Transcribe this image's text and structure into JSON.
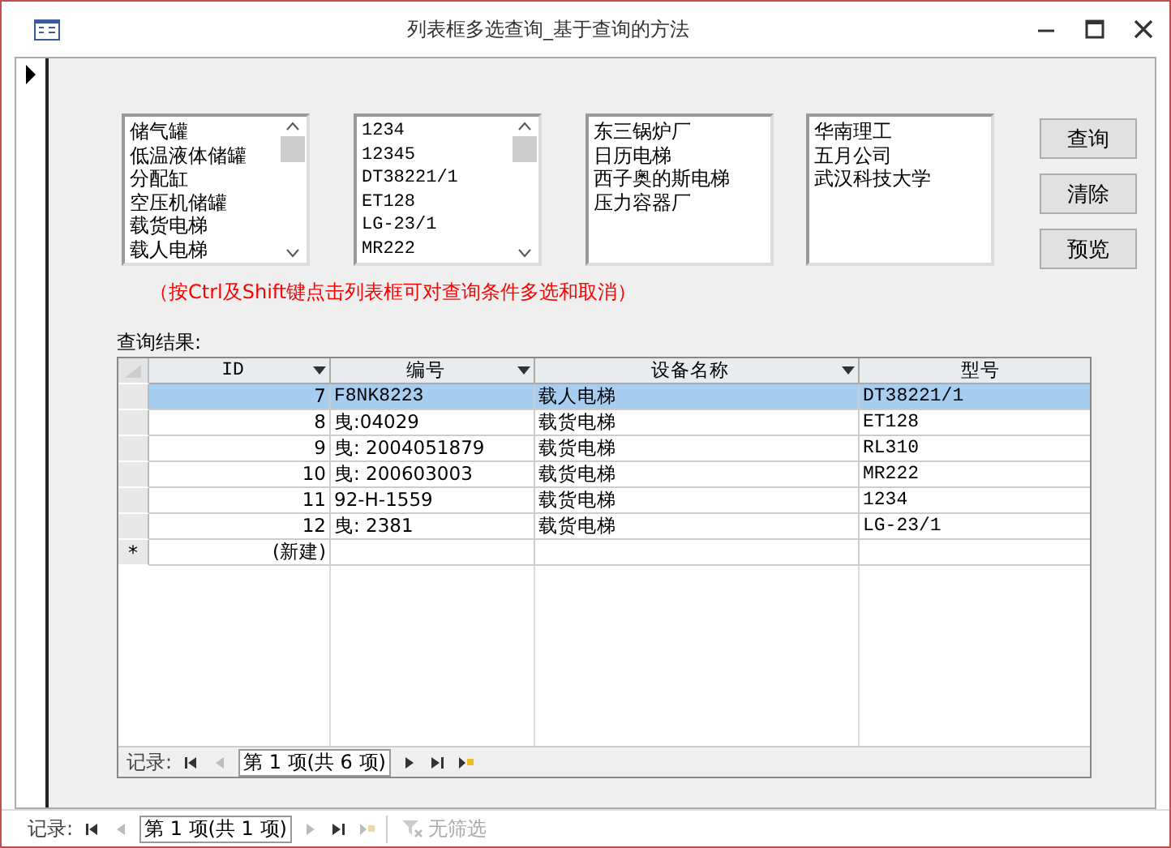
{
  "window": {
    "title": "列表框多选查询_基于查询的方法"
  },
  "listboxes": [
    {
      "items": [
        "储气罐",
        "低温液体储罐",
        "分配缸",
        "空压机储罐",
        "载货电梯",
        "载人电梯"
      ],
      "scrollbar": true
    },
    {
      "items": [
        "1234",
        "12345",
        "DT38221/1",
        "ET128",
        "LG-23/1",
        "MR222"
      ],
      "scrollbar": true
    },
    {
      "items": [
        "东三锅炉厂",
        "日历电梯",
        "西子奥的斯电梯",
        "压力容器厂"
      ],
      "scrollbar": false
    },
    {
      "items": [
        "华南理工",
        "五月公司",
        "武汉科技大学"
      ],
      "scrollbar": false
    }
  ],
  "buttons": [
    "查询",
    "清除",
    "预览"
  ],
  "hint": "（按Ctrl及Shift键点击列表框可对查询条件多选和取消）",
  "results_label": "查询结果:",
  "table": {
    "columns": [
      {
        "label": "ID",
        "dropdown": true
      },
      {
        "label": "编号",
        "dropdown": true
      },
      {
        "label": "设备名称",
        "dropdown": true
      },
      {
        "label": "型号",
        "dropdown": false
      }
    ],
    "rows": [
      {
        "cells": [
          "7",
          "F8NK8223",
          "载人电梯",
          "DT38221/1"
        ],
        "selected": true
      },
      {
        "cells": [
          "8",
          "曳:04029",
          "载货电梯",
          "ET128"
        ],
        "selected": false
      },
      {
        "cells": [
          "9",
          "曳: 2004051879",
          "载货电梯",
          "RL310"
        ],
        "selected": false
      },
      {
        "cells": [
          "10",
          "曳: 200603003",
          "载货电梯",
          "MR222"
        ],
        "selected": false
      },
      {
        "cells": [
          "11",
          "92-H-1559",
          "载货电梯",
          "1234"
        ],
        "selected": false
      },
      {
        "cells": [
          "12",
          "曳: 2381",
          "载货电梯",
          "LG-23/1"
        ],
        "selected": false
      }
    ],
    "new_row": {
      "marker": "*",
      "label": "(新建)"
    }
  },
  "subform_nav": {
    "label": "记录:",
    "position": "第 1 项(共 6 项)"
  },
  "form_nav": {
    "label": "记录:",
    "position": "第 1 项(共 1 项)",
    "filter": "无筛选"
  }
}
